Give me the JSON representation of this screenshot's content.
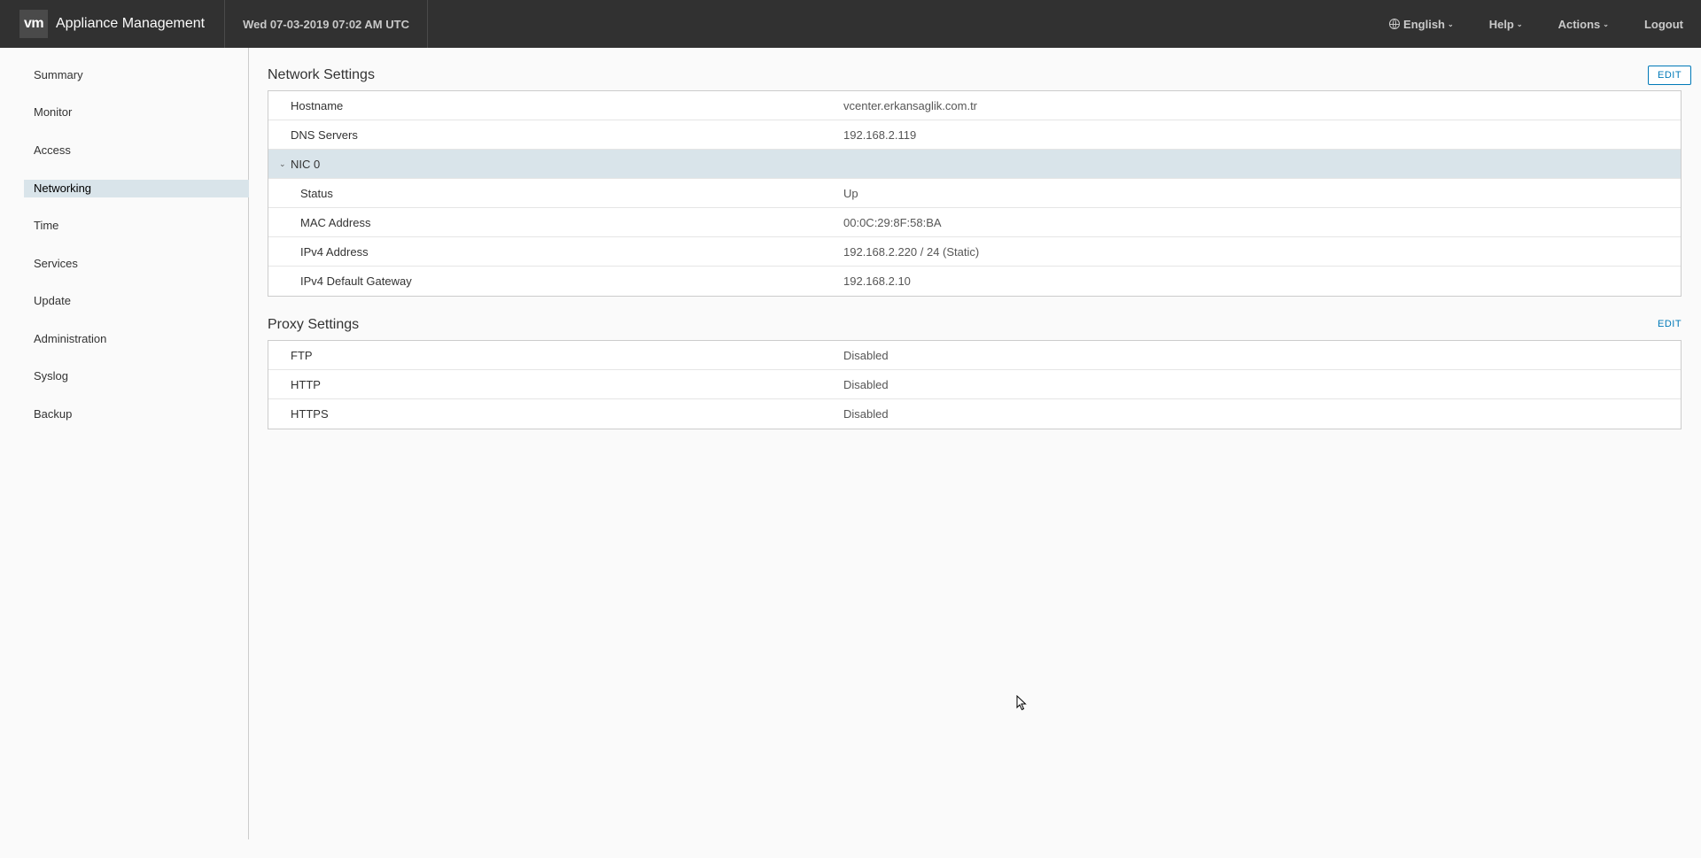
{
  "header": {
    "logo_text": "vm",
    "app_title": "Appliance Management",
    "datetime": "Wed 07-03-2019 07:02 AM UTC",
    "language": "English",
    "help": "Help",
    "actions": "Actions",
    "logout": "Logout"
  },
  "sidebar": {
    "items": [
      {
        "label": "Summary"
      },
      {
        "label": "Monitor"
      },
      {
        "label": "Access"
      },
      {
        "label": "Networking"
      },
      {
        "label": "Time"
      },
      {
        "label": "Services"
      },
      {
        "label": "Update"
      },
      {
        "label": "Administration"
      },
      {
        "label": "Syslog"
      },
      {
        "label": "Backup"
      }
    ],
    "active": "Networking"
  },
  "network": {
    "title": "Network Settings",
    "edit_label": "EDIT",
    "hostname_label": "Hostname",
    "hostname_value": "vcenter.erkansaglik.com.tr",
    "dns_label": "DNS Servers",
    "dns_value": "192.168.2.119",
    "nic_label": "NIC 0",
    "status_label": "Status",
    "status_value": "Up",
    "mac_label": "MAC Address",
    "mac_value": "00:0C:29:8F:58:BA",
    "ipv4_label": "IPv4 Address",
    "ipv4_value": "192.168.2.220 / 24 (Static)",
    "gateway_label": "IPv4 Default Gateway",
    "gateway_value": "192.168.2.10"
  },
  "proxy": {
    "title": "Proxy Settings",
    "edit_label": "EDIT",
    "ftp_label": "FTP",
    "ftp_value": "Disabled",
    "http_label": "HTTP",
    "http_value": "Disabled",
    "https_label": "HTTPS",
    "https_value": "Disabled"
  },
  "colors": {
    "header_bg": "#313131",
    "accent": "#0079b8",
    "active_nav_bg": "#d9e4ea"
  }
}
